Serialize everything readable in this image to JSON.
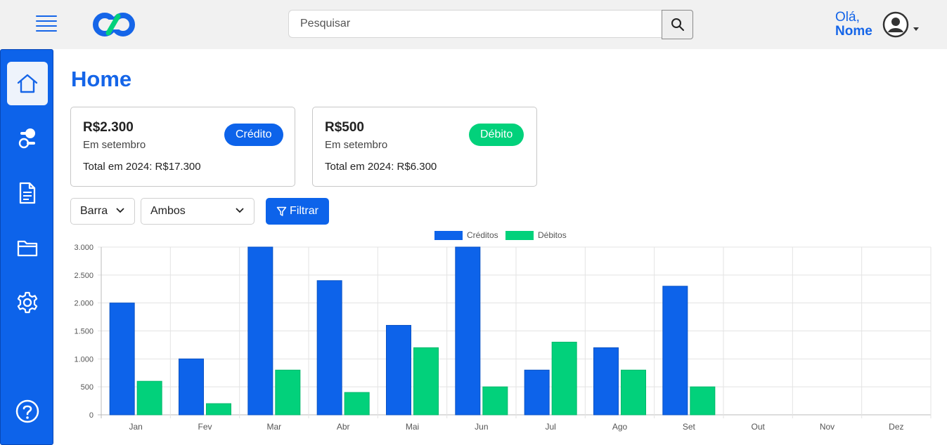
{
  "header": {
    "search_placeholder": "Pesquisar",
    "greeting": "Olá,",
    "user_name": "Nome"
  },
  "sidebar": {
    "items": [
      {
        "name": "home",
        "icon": "home-icon",
        "active": true
      },
      {
        "name": "transactions",
        "icon": "toggle-nodes-icon",
        "active": false
      },
      {
        "name": "reports",
        "icon": "document-icon",
        "active": false
      },
      {
        "name": "files",
        "icon": "folder-icon",
        "active": false
      },
      {
        "name": "settings",
        "icon": "gear-icon",
        "active": false
      },
      {
        "name": "help",
        "icon": "help-icon",
        "active": false
      }
    ]
  },
  "main": {
    "title": "Home",
    "cards": [
      {
        "amount": "R$2.300",
        "period": "Em setembro",
        "total": "Total em 2024: R$17.300",
        "badge": "Crédito",
        "badge_color": "#0d63ea"
      },
      {
        "amount": "R$500",
        "period": "Em setembro",
        "total": "Total em 2024: R$6.300",
        "badge": "Débito",
        "badge_color": "#02d17b"
      }
    ],
    "filters": {
      "chart_type": "Barra",
      "scope": "Ambos",
      "button": "Filtrar"
    }
  },
  "colors": {
    "accent": "#0d63ea",
    "credit": "#0d63ea",
    "debit": "#02d17b"
  },
  "chart_data": {
    "type": "bar",
    "categories": [
      "Jan",
      "Fev",
      "Mar",
      "Abr",
      "Mai",
      "Jun",
      "Jul",
      "Ago",
      "Set",
      "Out",
      "Nov",
      "Dez"
    ],
    "series": [
      {
        "name": "Créditos",
        "color": "#0d63ea",
        "values": [
          2000,
          1000,
          3000,
          2400,
          1600,
          3000,
          800,
          1200,
          2300,
          null,
          null,
          null
        ]
      },
      {
        "name": "Débitos",
        "color": "#02d17b",
        "values": [
          600,
          200,
          800,
          400,
          1200,
          500,
          1300,
          800,
          500,
          null,
          null,
          null
        ]
      }
    ],
    "y_ticks": [
      "0",
      "500",
      "1.000",
      "1.500",
      "2.000",
      "2.500",
      "3.000"
    ],
    "ylim": [
      0,
      3000
    ],
    "grid": true,
    "legend": "top-center"
  }
}
